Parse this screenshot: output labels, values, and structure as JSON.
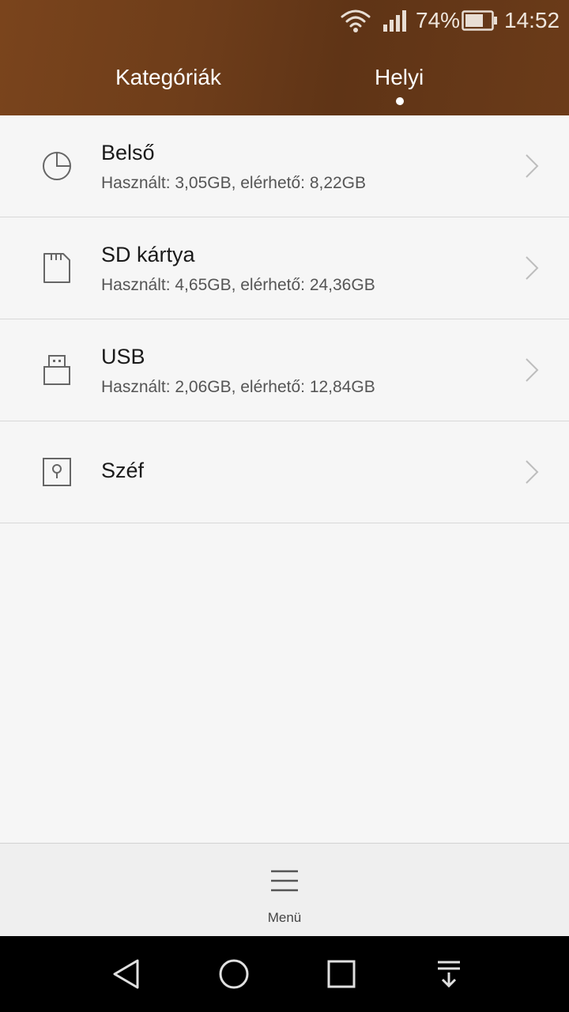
{
  "status_bar": {
    "battery_percent": "74%",
    "time": "14:52",
    "icons": [
      "wifi-icon",
      "signal-icon",
      "battery-icon"
    ]
  },
  "tabs": [
    {
      "label": "Kategóriák",
      "selected": false
    },
    {
      "label": "Helyi",
      "selected": true
    }
  ],
  "storage_items": [
    {
      "title": "Belső",
      "subtitle": "Használt: 3,05GB, elérhető: 8,22GB",
      "icon": "pie-chart-icon"
    },
    {
      "title": "SD kártya",
      "subtitle": "Használt: 4,65GB, elérhető: 24,36GB",
      "icon": "sd-card-icon"
    },
    {
      "title": "USB",
      "subtitle": "Használt: 2,06GB, elérhető: 12,84GB",
      "icon": "usb-icon"
    },
    {
      "title": "Széf",
      "icon": "safe-icon"
    }
  ],
  "bottom_bar": {
    "menu_label": "Menü",
    "icon": "menu-icon"
  },
  "nav_bar": {
    "icons": [
      "back-icon",
      "home-icon",
      "recent-apps-icon",
      "notifications-icon"
    ]
  },
  "colors": {
    "header": "#6b3b19",
    "background": "#f6f6f6",
    "bottom_bar": "#efefef",
    "nav_bar": "#000000"
  }
}
